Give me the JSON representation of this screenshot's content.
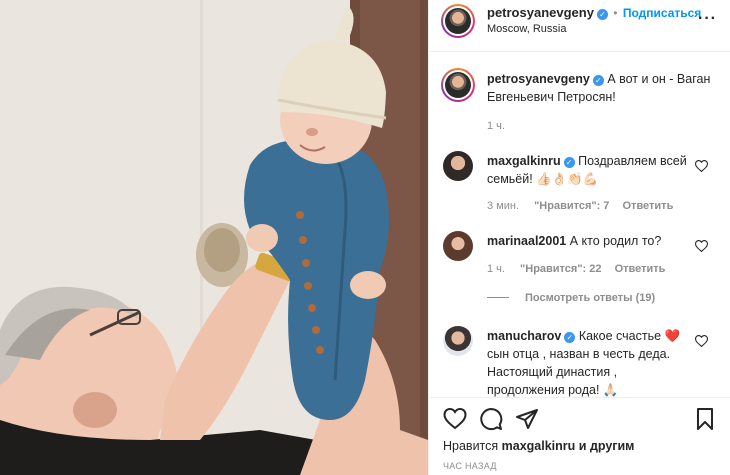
{
  "header": {
    "username": "petrosyanevgeny",
    "separator": "•",
    "follow_label": "Подписаться",
    "location": "Moscow, Russia"
  },
  "caption": {
    "username": "petrosyanevgeny",
    "text": "А вот и он - Ваган Евгеньевич Петросян!",
    "time": "1 ч."
  },
  "comments": [
    {
      "username": "maxgalkinru",
      "verified": true,
      "text": "Поздравляем всей семьёй! 👍🏻👌🏻👏🏻💪🏻",
      "time": "3 мин.",
      "likes": "\"Нравится\": 7",
      "reply": "Ответить"
    },
    {
      "username": "marinaal2001",
      "verified": false,
      "text": "А кто родил то?",
      "time": "1 ч.",
      "likes": "\"Нравится\": 22",
      "reply": "Ответить",
      "view_replies": "Посмотреть ответы (19)"
    },
    {
      "username": "manucharov",
      "verified": true,
      "text": "Какое счастье ❤️сын отца , назван в честь деда. Настоящий династия , продолжения рода! 🙏🏻"
    }
  ],
  "footer": {
    "liked_by_prefix": "Нравится",
    "liked_by_user": "maxgalkinru",
    "liked_by_suffix": "и другим",
    "timestamp": "час назад"
  },
  "icons": {
    "like": "heart-outline-icon",
    "comment": "comment-bubble-icon",
    "share": "paper-plane-icon",
    "save": "bookmark-icon",
    "more": "more-dots-icon"
  },
  "colors": {
    "accent_blue": "#0095f6",
    "verified_blue": "#3897f0",
    "muted": "#8e8e8e",
    "text": "#262626"
  }
}
